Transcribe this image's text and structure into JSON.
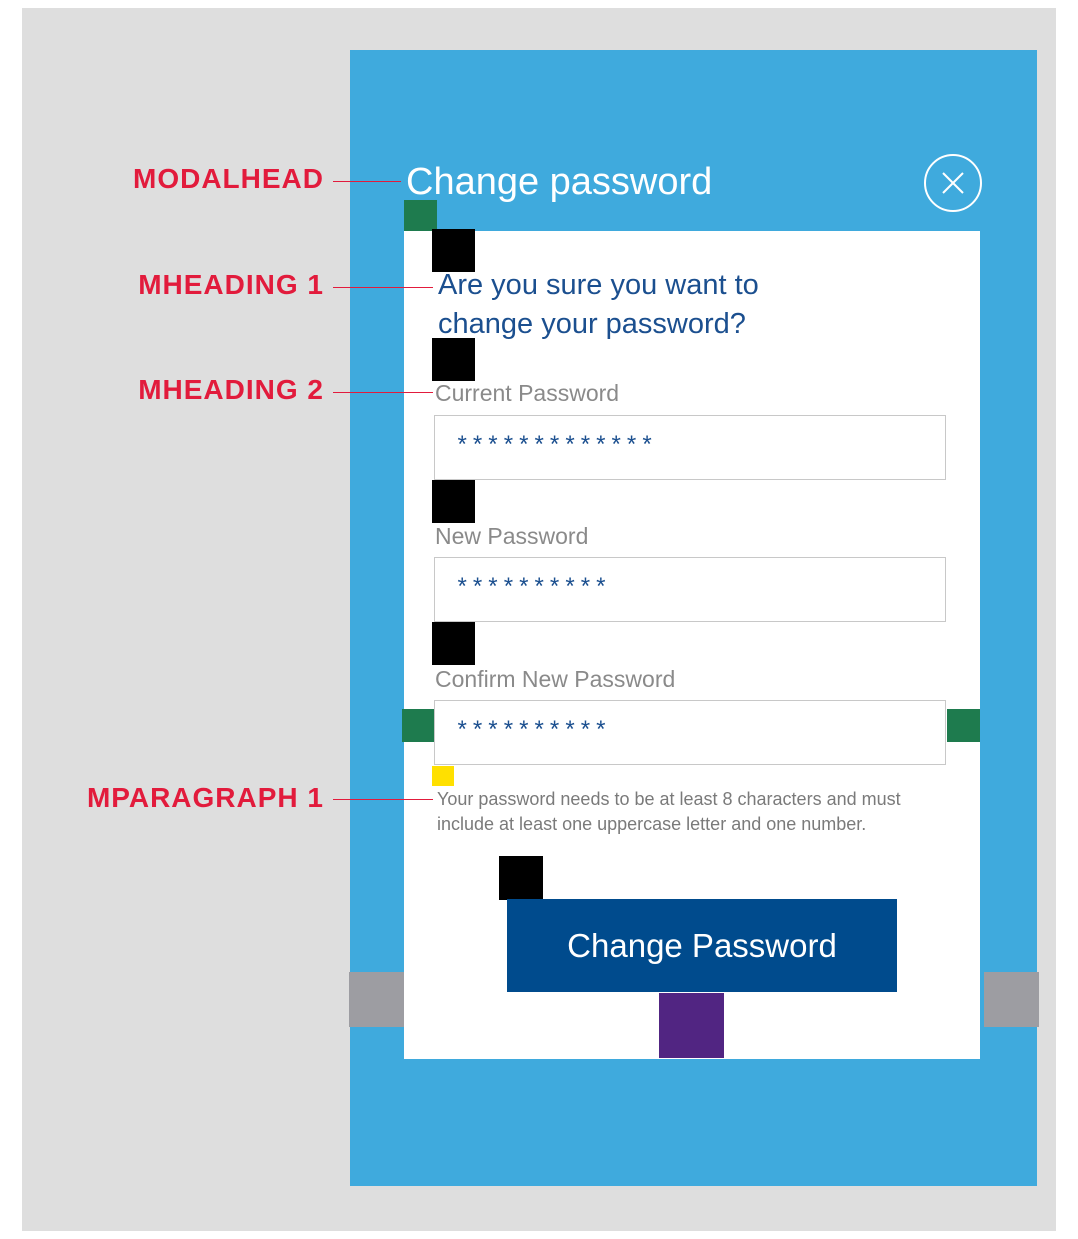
{
  "modal": {
    "title": "Change password",
    "question": "Are you sure you want to change your password?",
    "fields": [
      {
        "label": "Current Password",
        "value": "*************"
      },
      {
        "label": "New Password",
        "value": "**********"
      },
      {
        "label": "Confirm New Password",
        "value": "**********"
      }
    ],
    "hint": "Your password needs to be at least 8 characters and must include at least one uppercase letter and one number.",
    "submit_label": "Change Password"
  },
  "annotations": {
    "modalhead": "MODALHEAD",
    "mheading1": "MHEADING 1",
    "mheading2": "MHEADING 2",
    "mparagraph1": "MPARAGRAPH 1"
  },
  "colors": {
    "modal_background": "#3faadd",
    "heading_blue": "#1b4f8f",
    "button_blue": "#004b8d",
    "annotation_red": "#e21b3c"
  },
  "icons": {
    "close": "close-circle-icon"
  }
}
